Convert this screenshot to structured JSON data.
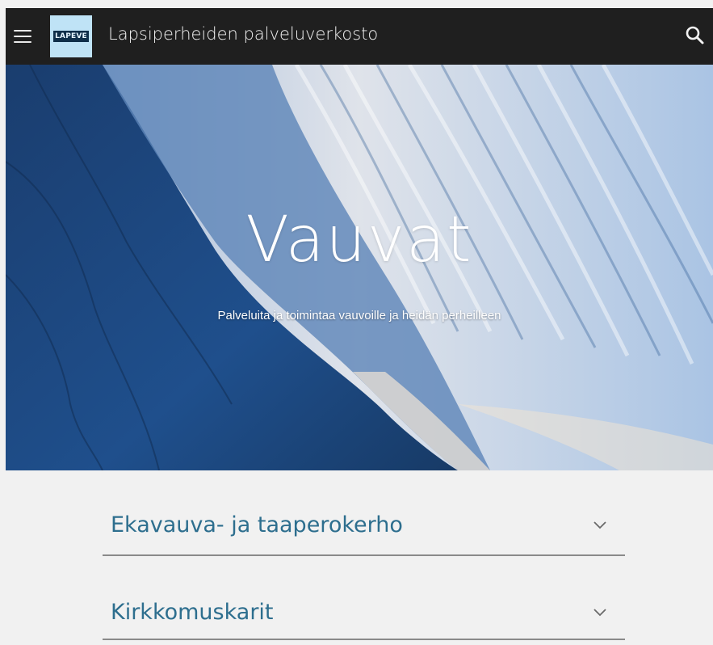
{
  "header": {
    "logo_text": "LAPEVE",
    "site_title": "Lapsiperheiden palveluverkosto",
    "icons": {
      "menu": "menu-icon",
      "search": "search-icon"
    }
  },
  "hero": {
    "title": "Vauvat",
    "subtitle": "Palveluita ja toimintaa vauvoille ja heidän perheilleen"
  },
  "accordion": {
    "items": [
      {
        "label": "Ekavauva- ja taaperokerho",
        "icon": "chevron-down-icon"
      },
      {
        "label": "Kirkkomuskarit",
        "icon": "chevron-down-icon"
      }
    ]
  },
  "colors": {
    "topbar": "#1f1f1f",
    "logo_bg": "#bfe3f6",
    "accordion_text": "#2d6e8e",
    "divider": "#8a8a8a",
    "page_bg": "#f1f1f1"
  }
}
